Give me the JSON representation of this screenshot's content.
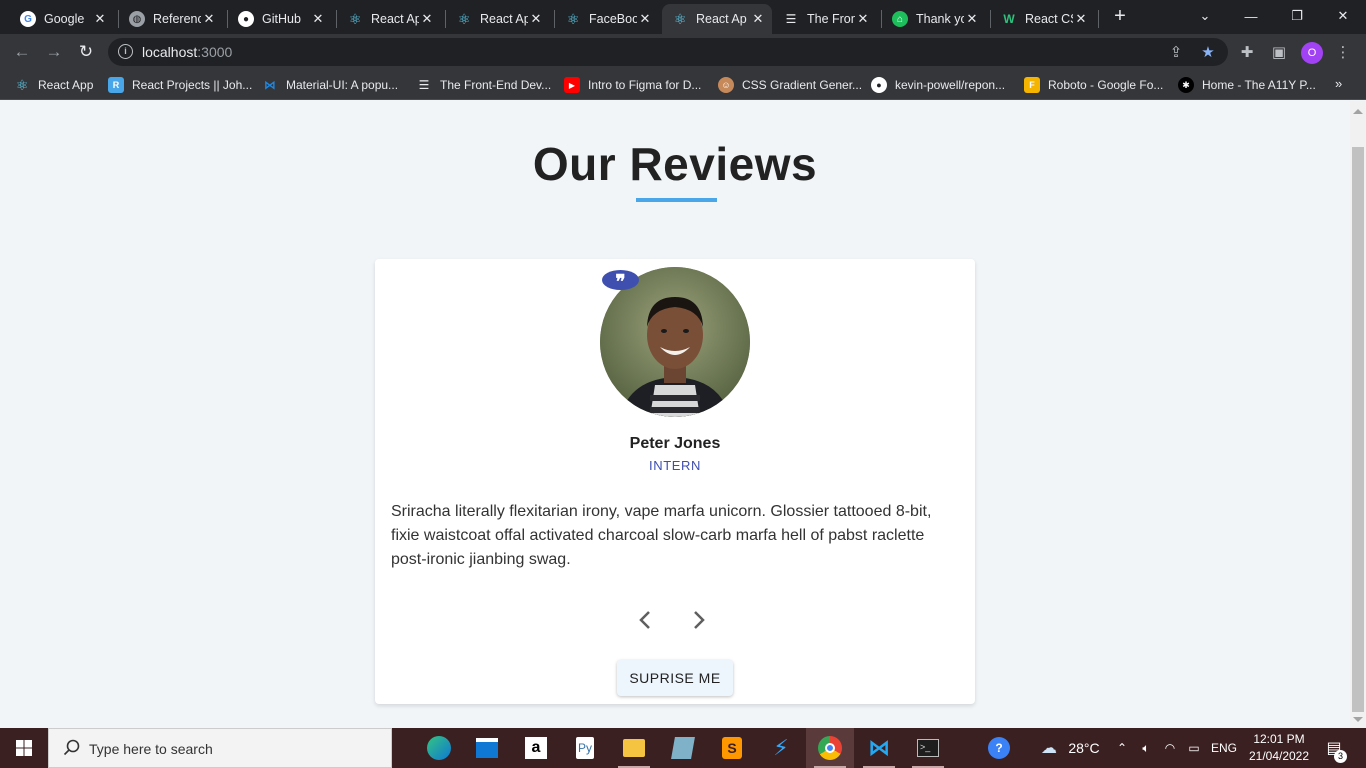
{
  "browser": {
    "tabs": [
      {
        "title": "Google",
        "icon": "google-icon",
        "active": false
      },
      {
        "title": "Referenc",
        "icon": "globe-icon",
        "active": false
      },
      {
        "title": "GitHub",
        "icon": "github-icon",
        "active": false
      },
      {
        "title": "React Ap",
        "icon": "react-icon",
        "active": false
      },
      {
        "title": "React Ap",
        "icon": "react-icon",
        "active": false
      },
      {
        "title": "FaceBoo",
        "icon": "react-icon",
        "active": false
      },
      {
        "title": "React Ap",
        "icon": "react-icon",
        "active": true
      },
      {
        "title": "The Fron",
        "icon": "frontend-icon",
        "active": false
      },
      {
        "title": "Thank yo",
        "icon": "thankyou-icon",
        "active": false
      },
      {
        "title": "React CS",
        "icon": "w-icon",
        "active": false
      }
    ],
    "address": {
      "host": "localhost",
      "port": ":3000"
    },
    "profile_initial": "O",
    "bookmarks": [
      {
        "label": "React App",
        "icon": "react-icon"
      },
      {
        "label": "React Projects || Joh...",
        "icon": "r-icon"
      },
      {
        "label": "Material-UI: A popu...",
        "icon": "material-ui-icon"
      },
      {
        "label": "The Front-End Dev...",
        "icon": "frontend-icon"
      },
      {
        "label": "Intro to Figma for D...",
        "icon": "youtube-icon"
      },
      {
        "label": "CSS Gradient Gener...",
        "icon": "gradient-icon"
      },
      {
        "label": "kevin-powell/repon...",
        "icon": "github-icon"
      },
      {
        "label": "Roboto - Google Fo...",
        "icon": "google-fonts-icon"
      },
      {
        "label": "Home - The A11Y P...",
        "icon": "a11y-icon"
      }
    ],
    "more_glyph": "»"
  },
  "page": {
    "title": "Our Reviews",
    "accent_color": "#49a6e9",
    "review": {
      "name": "Peter Jones",
      "job": "INTERN",
      "text": "Sriracha literally flexitarian irony, vape marfa unicorn. Glossier tattooed 8-bit, fixie waistcoat offal activated charcoal slow-carb marfa hell of pabst raclette post-ironic jianbing swag.",
      "quote_glyph": "❞"
    },
    "random_button": "SUPRISE ME"
  },
  "taskbar": {
    "search_placeholder": "Type here to search",
    "weather": "28°C",
    "language": "ENG",
    "time": "12:01 PM",
    "date": "21/04/2022",
    "notification_count": "3"
  }
}
